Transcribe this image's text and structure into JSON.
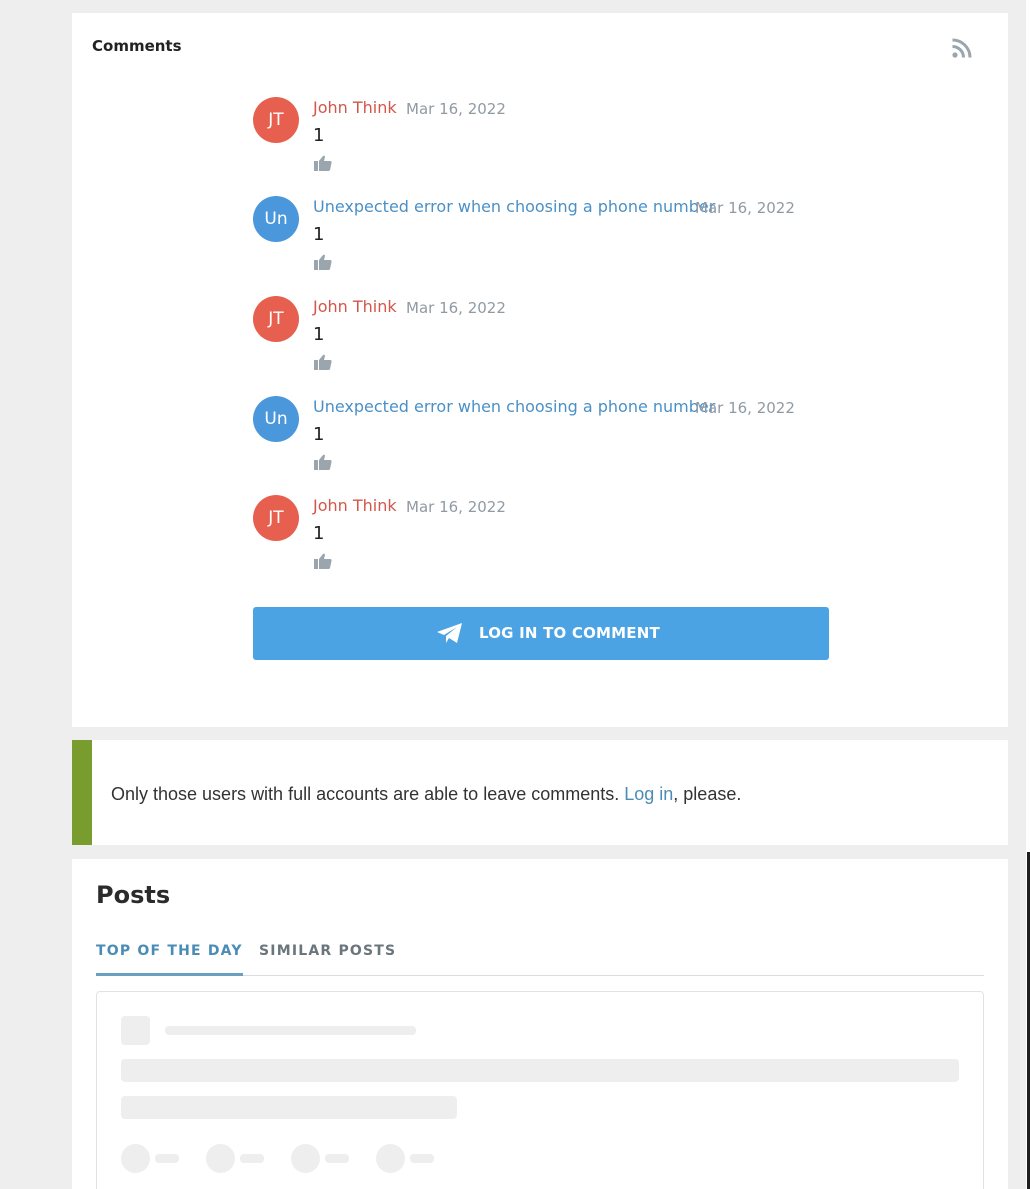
{
  "comments": {
    "title": "Comments",
    "items": [
      {
        "initials": "JT",
        "author": "John Think",
        "date": "Mar 16, 2022",
        "text": "1",
        "style": "red"
      },
      {
        "initials": "Un",
        "author": "Unexpected error when choosing a phone number",
        "date": "Mar 16, 2022",
        "text": "1",
        "style": "blue"
      },
      {
        "initials": "JT",
        "author": "John Think",
        "date": "Mar 16, 2022",
        "text": "1",
        "style": "red"
      },
      {
        "initials": "Un",
        "author": "Unexpected error when choosing a phone number",
        "date": "Mar 16, 2022",
        "text": "1",
        "style": "blue"
      },
      {
        "initials": "JT",
        "author": "John Think",
        "date": "Mar 16, 2022",
        "text": "1",
        "style": "red"
      }
    ],
    "login_button": "LOG IN TO COMMENT"
  },
  "notice": {
    "text_before": "Only those users with full accounts are able to leave comments. ",
    "link": "Log in",
    "text_after": ", please."
  },
  "posts": {
    "title": "Posts",
    "tabs": [
      {
        "label": "TOP OF THE DAY",
        "active": true
      },
      {
        "label": "SIMILAR POSTS",
        "active": false
      }
    ]
  },
  "colors": {
    "accent": "#4ba3e3",
    "author_red": "#d3564a",
    "author_blue": "#4a90c6",
    "notice_stripe": "#789c2e"
  },
  "icons": {
    "feed": "rss-icon",
    "like": "thumbs-up-icon",
    "send": "paper-plane-icon"
  }
}
